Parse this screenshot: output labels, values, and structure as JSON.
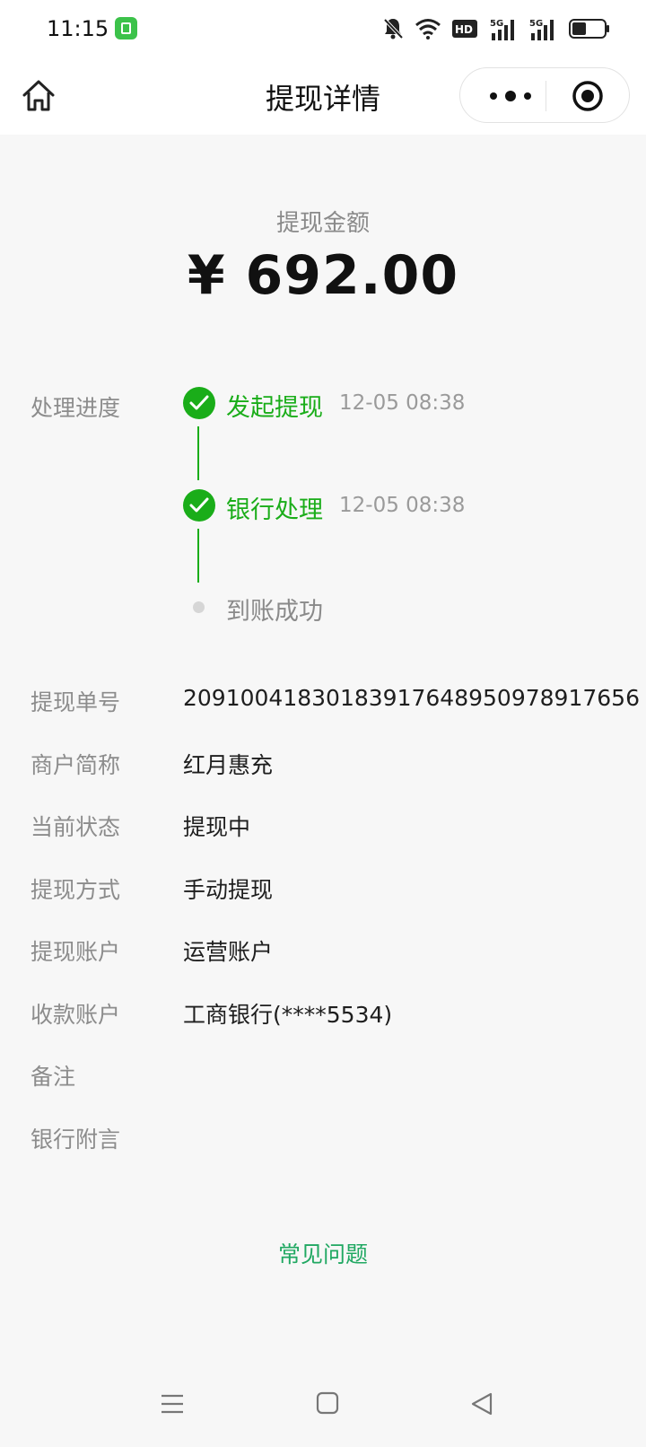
{
  "status_bar": {
    "time": "11:15",
    "icons": [
      "notifications-off-icon",
      "wifi-icon",
      "hd-icon",
      "signal-5g-icon",
      "signal-5g-icon",
      "battery-icon"
    ],
    "hd_text": "HD",
    "network_1": "5G",
    "network_2": "5G",
    "battery_level": 0.45
  },
  "header": {
    "title": "提现详情",
    "home_icon": "home-icon",
    "more_icon": "more-dots-icon",
    "close_icon": "target-circle-icon"
  },
  "amount": {
    "label": "提现金额",
    "value": "¥ 692.00"
  },
  "progress": {
    "label": "处理进度",
    "steps": [
      {
        "name": "发起提现",
        "time": "12-05 08:38",
        "done": true
      },
      {
        "name": "银行处理",
        "time": "12-05 08:38",
        "done": true
      },
      {
        "name": "到账成功",
        "time": "",
        "done": false
      }
    ]
  },
  "details": [
    {
      "label": "提现单号",
      "value": "209100418301839176489509789176​56"
    },
    {
      "label": "商户简称",
      "value": "红月惠充"
    },
    {
      "label": "当前状态",
      "value": "提现中"
    },
    {
      "label": "提现方式",
      "value": "手动提现"
    },
    {
      "label": "提现账户",
      "value": "运营账户"
    },
    {
      "label": "收款账户",
      "value": "工商银行(****5534)"
    },
    {
      "label": "备注",
      "value": ""
    },
    {
      "label": "银行附言",
      "value": ""
    }
  ],
  "faq_link": "常见问题",
  "colors": {
    "accent": "#1aad19",
    "link": "#20a862",
    "background": "#f7f7f7"
  }
}
